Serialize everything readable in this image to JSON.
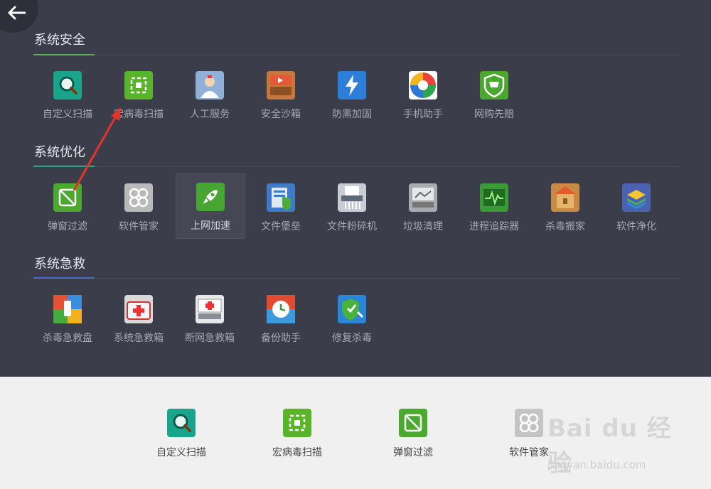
{
  "sections": [
    {
      "title": "系统安全",
      "accent": "#5fae57",
      "items": [
        {
          "label": "自定义扫描",
          "icon": "magnifier-icon",
          "color": "#18a58c"
        },
        {
          "label": "宏病毒扫描",
          "icon": "grid-scan-icon",
          "color": "#58b52a"
        },
        {
          "label": "人工服务",
          "icon": "doctor-icon",
          "color": "#8fb1d8"
        },
        {
          "label": "安全沙箱",
          "icon": "sandbox-icon",
          "color": "#c7773c"
        },
        {
          "label": "防黑加固",
          "icon": "lightning-icon",
          "color": "#2c7fd8"
        },
        {
          "label": "手机助手",
          "icon": "colorwheel-icon",
          "color": "#e9433b"
        },
        {
          "label": "网购先赔",
          "icon": "shopping-cart-icon",
          "color": "#4aa82c"
        }
      ]
    },
    {
      "title": "系统优化",
      "accent": "#34a584",
      "items": [
        {
          "label": "弹窗过滤",
          "icon": "popup-block-icon",
          "color": "#4aaa2e"
        },
        {
          "label": "软件管家",
          "icon": "flower-icon",
          "color": "#b9b9b9"
        },
        {
          "label": "上网加速",
          "icon": "rocket-icon",
          "color": "#46a533"
        },
        {
          "label": "文件堡垒",
          "icon": "file-fortress-icon",
          "color": "#3d7bc8"
        },
        {
          "label": "文件粉碎机",
          "icon": "shredder-icon",
          "color": "#c8ccd4"
        },
        {
          "label": "垃圾清理",
          "icon": "trash-clean-icon",
          "color": "#a9abb0"
        },
        {
          "label": "进程追踪器",
          "icon": "pulse-icon",
          "color": "#3a9a35"
        },
        {
          "label": "杀毒搬家",
          "icon": "house-box-icon",
          "color": "#c98a44"
        },
        {
          "label": "软件净化",
          "icon": "layers-icon",
          "color": "#4a62b0"
        }
      ]
    },
    {
      "title": "系统急救",
      "accent": "#4a6dc4",
      "items": [
        {
          "label": "杀毒急救盘",
          "icon": "usb-disk-icon",
          "color": "#e45135"
        },
        {
          "label": "系统急救箱",
          "icon": "first-aid-icon",
          "color": "#d9d9d9"
        },
        {
          "label": "断网急救箱",
          "icon": "network-aid-icon",
          "color": "#e8e8ea"
        },
        {
          "label": "备份助手",
          "icon": "backup-clock-icon",
          "color": "#e8762e"
        },
        {
          "label": "修复杀毒",
          "icon": "repair-shield-icon",
          "color": "#2a86d8"
        }
      ]
    }
  ],
  "quick_bar": [
    {
      "label": "自定义扫描",
      "icon": "magnifier-icon",
      "color": "#18a58c"
    },
    {
      "label": "宏病毒扫描",
      "icon": "grid-scan-icon",
      "color": "#58b52a"
    },
    {
      "label": "弹窗过滤",
      "icon": "popup-block-icon",
      "color": "#4aaa2e"
    },
    {
      "label": "软件管家",
      "icon": "flower-icon",
      "color": "#c4c4c4"
    }
  ],
  "watermark": {
    "brand": "Bai du 经验",
    "url": "jingyan.baidu.com"
  },
  "annotation": {
    "color": "#e8322c"
  }
}
